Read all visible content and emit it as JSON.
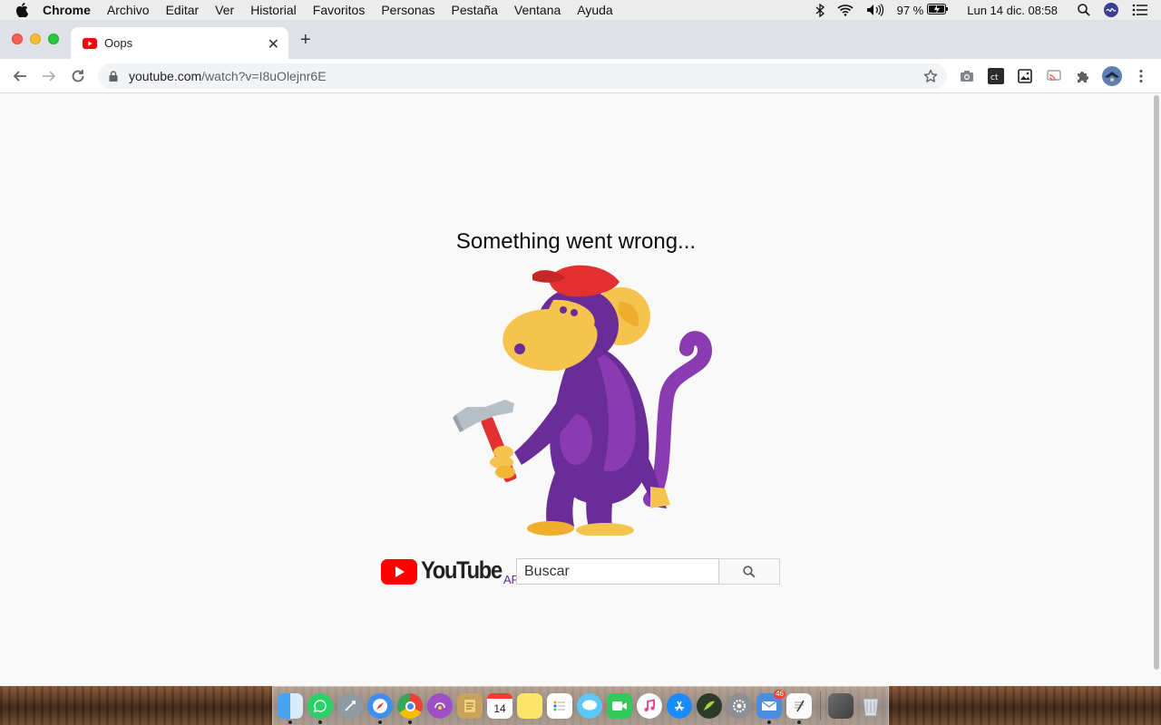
{
  "menubar": {
    "app_name": "Chrome",
    "menus": [
      "Archivo",
      "Editar",
      "Ver",
      "Historial",
      "Favoritos",
      "Personas",
      "Pestaña",
      "Ventana",
      "Ayuda"
    ],
    "battery": "97 %",
    "datetime": "Lun 14 dic.  08:58"
  },
  "browser": {
    "tab_title": "Oops",
    "url_host": "youtube.com",
    "url_path": "/watch?v=I8uOlejnr6E"
  },
  "page": {
    "error_message": "Something went wrong...",
    "logo_text": "YouTube",
    "country_code": "AR",
    "search_placeholder": "Buscar"
  },
  "colors": {
    "youtube_red": "#ff0000",
    "monkey_purple": "#6a2c97",
    "monkey_yellow": "#f5c44f"
  },
  "dock": {
    "calendar_day": "14",
    "mail_badge": "46",
    "apps": [
      "finder-icon",
      "whatsapp-icon",
      "launchpad-icon",
      "safari-icon",
      "chrome-icon",
      "podcast-icon",
      "notes-app-icon",
      "calendar-icon",
      "stickies-icon",
      "reminders-icon",
      "messages-icon",
      "facetime-icon",
      "itunes-icon",
      "app-store-icon",
      "vpn-icon",
      "system-preferences-icon",
      "mail-icon",
      "textedit-icon",
      "downloads-stack-icon",
      "trash-icon"
    ]
  }
}
